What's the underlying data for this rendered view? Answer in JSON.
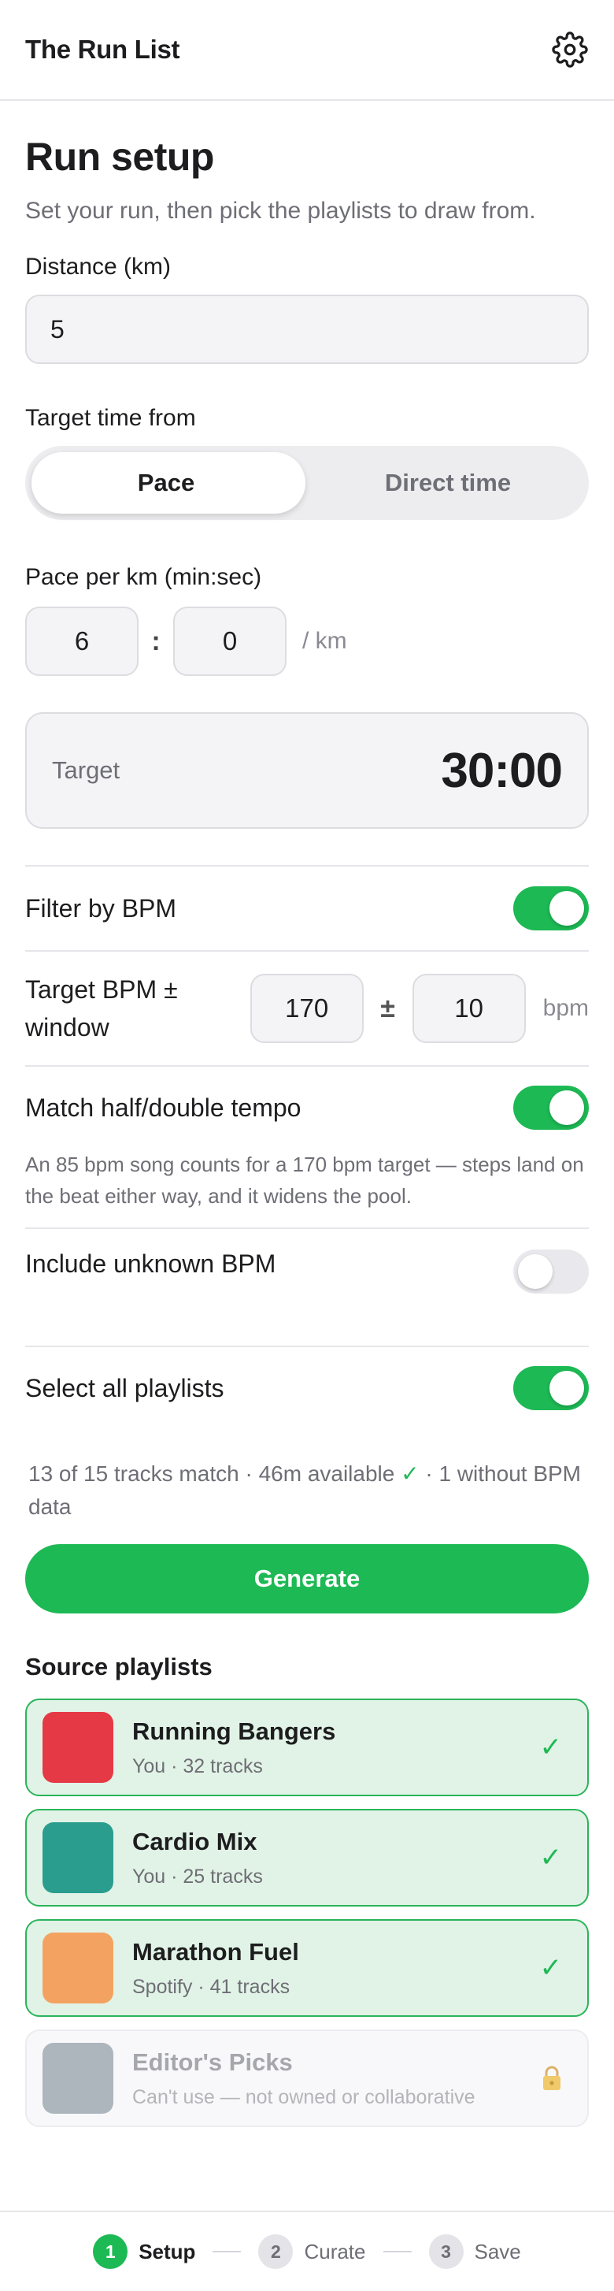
{
  "header": {
    "title": "The Run List"
  },
  "setup": {
    "title": "Run setup",
    "subtitle": "Set your run, then pick the playlists to draw from.",
    "distance_label": "Distance (km)",
    "distance_value": "5",
    "target_from_label": "Target time from",
    "target_from_options": [
      "Pace",
      "Direct time"
    ],
    "target_from_selected": "Pace",
    "pace_label": "Pace per km (min:sec)",
    "pace_min": "6",
    "pace_sec": "0",
    "pace_sep": ":",
    "pace_unit": "/ km",
    "target_label": "Target",
    "target_value": "30:00"
  },
  "bpm": {
    "filter_label": "Filter by BPM",
    "filter_on": true,
    "target_label": "Target BPM ± window",
    "target_value": "170",
    "pm_symbol": "±",
    "window_value": "10",
    "unit": "bpm",
    "halfdouble_label": "Match half/double tempo",
    "halfdouble_on": true,
    "halfdouble_help": "An 85 bpm song counts for a 170 bpm target — steps land on the beat either way, and it widens the pool.",
    "unknown_label": "Include unknown BPM",
    "unknown_on": false
  },
  "selection": {
    "select_all_label": "Select all playlists",
    "select_all_on": true,
    "summary_before": "13 of 15 tracks match · 46m available ",
    "summary_check": "✓",
    "summary_after": " · 1 without BPM data"
  },
  "generate_label": "Generate",
  "playlists_title": "Source playlists",
  "playlists": [
    {
      "name": "Running Bangers",
      "sub": "You · 32 tracks",
      "color": "#e63946",
      "state": "selected",
      "mark": "✓"
    },
    {
      "name": "Cardio Mix",
      "sub": "You · 25 tracks",
      "color": "#2a9d8f",
      "state": "selected",
      "mark": "✓"
    },
    {
      "name": "Marathon Fuel",
      "sub": "Spotify · 41 tracks",
      "color": "#f4a261",
      "state": "selected",
      "mark": "✓"
    },
    {
      "name": "Editor's Picks",
      "sub": "Can't use — not owned or collaborative",
      "color": "#adb5bd",
      "state": "locked",
      "icon": "lock-icon"
    }
  ],
  "steps": [
    {
      "num": "1",
      "label": "Setup",
      "active": true
    },
    {
      "num": "2",
      "label": "Curate",
      "active": false
    },
    {
      "num": "3",
      "label": "Save",
      "active": false
    }
  ],
  "colors": {
    "accent": "#1db954",
    "selected_bg": "#e1f3e6",
    "selected_border": "#2bb45b"
  },
  "icons": {
    "settings": "gear-icon"
  }
}
